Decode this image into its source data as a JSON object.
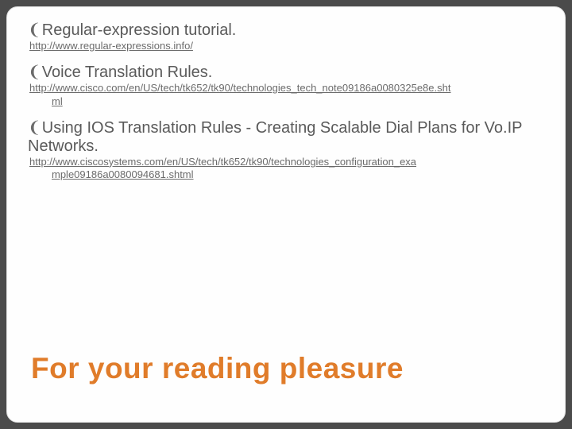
{
  "bullet_glyph": "❨",
  "items": [
    {
      "text": "Regular-expression tutorial.",
      "link_first": "http://www.regular-expressions.info/",
      "link_rest": ""
    },
    {
      "text": "Voice Translation Rules.",
      "link_first": "http://www.cisco.com/en/US/tech/tk652/tk90/technologies_tech_note09186a0080325e8e.sht",
      "link_rest": "ml"
    },
    {
      "text": "Using IOS Translation Rules - Creating Scalable Dial Plans for Vo.IP Networks.",
      "link_first": "http://www.ciscosystems.com/en/US/tech/tk652/tk90/technologies_configuration_exa",
      "link_rest": "mple09186a0080094681.shtml"
    }
  ],
  "title": "For your reading pleasure"
}
